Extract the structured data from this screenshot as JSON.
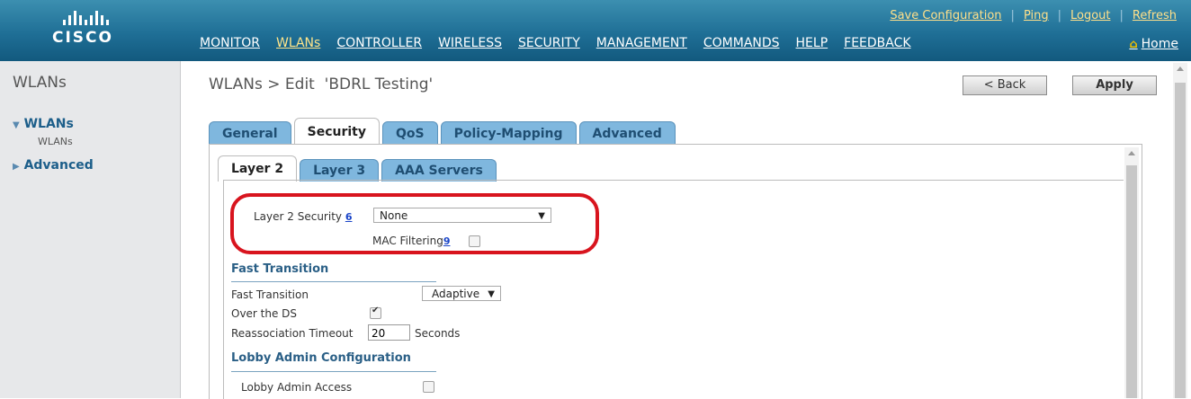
{
  "brand": {
    "logo_text": "CISCO"
  },
  "toplinks": {
    "save": "Save Configuration",
    "ping": "Ping",
    "logout": "Logout",
    "refresh": "Refresh"
  },
  "nav": [
    "MONITOR",
    "WLANs",
    "CONTROLLER",
    "WIRELESS",
    "SECURITY",
    "MANAGEMENT",
    "COMMANDS",
    "HELP",
    "FEEDBACK"
  ],
  "home": "Home",
  "sidebar": {
    "title": "WLANs",
    "wlans": "WLANs",
    "wlans_sub": "WLANs",
    "advanced": "Advanced"
  },
  "page": {
    "title": "WLANs > Edit  'BDRL Testing'",
    "back": "< Back",
    "apply": "Apply"
  },
  "tabs": [
    "General",
    "Security",
    "QoS",
    "Policy-Mapping",
    "Advanced"
  ],
  "subtabs": [
    "Layer 2",
    "Layer 3",
    "AAA Servers"
  ],
  "layer2": {
    "security_label": "Layer 2 Security",
    "security_help": "6",
    "security_value": "None",
    "mac_label": "MAC Filtering",
    "mac_help": "9",
    "mac_checked": false
  },
  "fast_transition": {
    "section": "Fast Transition",
    "ft_label": "Fast Transition",
    "ft_value": "Adaptive",
    "over_ds_label": "Over the DS",
    "over_ds_checked": true,
    "reassoc_label": "Reassociation Timeout",
    "reassoc_value": "20",
    "reassoc_unit": "Seconds"
  },
  "lobby": {
    "section": "Lobby Admin Configuration",
    "access_label": "Lobby Admin Access",
    "access_checked": false
  },
  "colors": {
    "header": "#1f6f96",
    "accent_link": "#ffe08a",
    "highlight_ring": "#d8141e",
    "tab": "#7fb7de"
  }
}
